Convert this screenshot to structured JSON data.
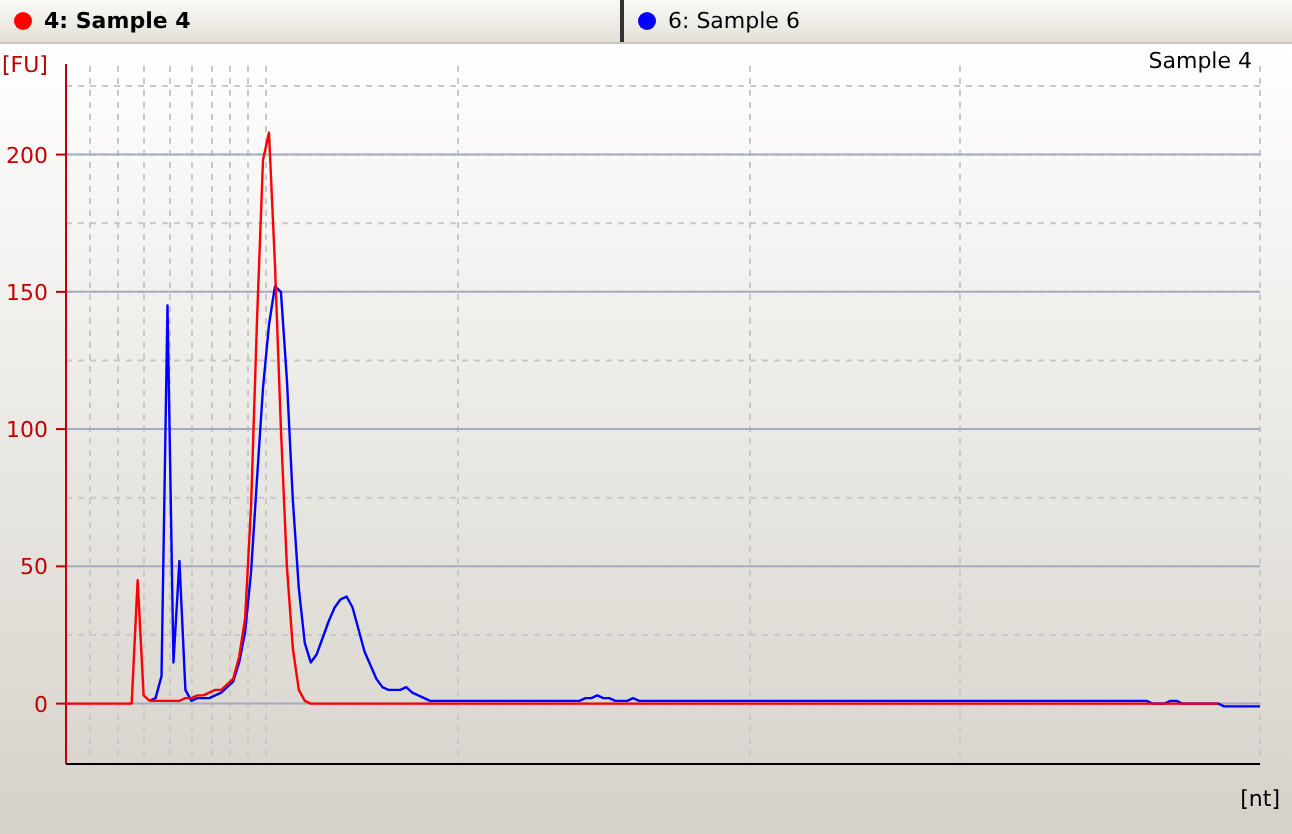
{
  "tabs": [
    {
      "label": "4: Sample 4",
      "color": "#ff0000",
      "selected": true
    },
    {
      "label": "6: Sample 6",
      "color": "#0000ff",
      "selected": false
    }
  ],
  "chart": {
    "chart_data": {
      "type": "line",
      "title": "Sample 4",
      "ylabel": "[FU]",
      "xlabel": "[nt]",
      "ylim": [
        -22,
        233
      ],
      "yticks": [
        0,
        50,
        100,
        150,
        200
      ],
      "grid": true,
      "categories": [
        null,
        null,
        null,
        null,
        null,
        null,
        null,
        null,
        null,
        null,
        null,
        null,
        null,
        null,
        null,
        null,
        null,
        null,
        null,
        null,
        null,
        null,
        null,
        null,
        null,
        null,
        null,
        null,
        null,
        null,
        null,
        null,
        null,
        null,
        null,
        null,
        null,
        null,
        null,
        null,
        null,
        null,
        null,
        null,
        null,
        null,
        null,
        null,
        null,
        null,
        null,
        null,
        null,
        null,
        null,
        null,
        null,
        null,
        null,
        null,
        null,
        null,
        null,
        null,
        null,
        null,
        null,
        null,
        null,
        null,
        null,
        null,
        null,
        null,
        null,
        null,
        null,
        null,
        null,
        null,
        null,
        null,
        null,
        null,
        null,
        null,
        null,
        null,
        null,
        null,
        null,
        null,
        null,
        null,
        null,
        null,
        null,
        null,
        null,
        null,
        null,
        null,
        null,
        null,
        null,
        null,
        null,
        null,
        null,
        null,
        null,
        null,
        null,
        null,
        null,
        null,
        null,
        null,
        null,
        null,
        null,
        null,
        null,
        null,
        null,
        null,
        null,
        null,
        null,
        null,
        null,
        null,
        null,
        null,
        null,
        null,
        null,
        null,
        null,
        null,
        null,
        null,
        null,
        null,
        null,
        null,
        null,
        null,
        null,
        null,
        null,
        null,
        null,
        null,
        null,
        null,
        null,
        null,
        null,
        null,
        null,
        null,
        null,
        null,
        null,
        null,
        null,
        null,
        null,
        null,
        null,
        null,
        null,
        null,
        null,
        null,
        null,
        null,
        null,
        null,
        null,
        null,
        null,
        null,
        null,
        null,
        null,
        null,
        null,
        null,
        null,
        null,
        null,
        null,
        null,
        null,
        null,
        null,
        null,
        null,
        null
      ],
      "series": [
        {
          "color": "#0000ff",
          "values": [
            null,
            null,
            null,
            null,
            null,
            null,
            null,
            null,
            null,
            null,
            null,
            null,
            null,
            null,
            1,
            2,
            10,
            145,
            15,
            52,
            5,
            1,
            2,
            2,
            2,
            3,
            4,
            6,
            8,
            15,
            26,
            48,
            82,
            115,
            138,
            152,
            150,
            118,
            74,
            42,
            22,
            15,
            18,
            24,
            30,
            35,
            38,
            39,
            35,
            27,
            19,
            14,
            9,
            6,
            5,
            5,
            5,
            6,
            4,
            3,
            2,
            1,
            1,
            1,
            1,
            1,
            1,
            1,
            1,
            1,
            1,
            1,
            1,
            1,
            1,
            1,
            1,
            1,
            1,
            1,
            1,
            1,
            1,
            1,
            1,
            1,
            1,
            2,
            2,
            3,
            2,
            2,
            1,
            1,
            1,
            2,
            1,
            1,
            1,
            1,
            1,
            1,
            1,
            1,
            1,
            1,
            1,
            1,
            1,
            1,
            1,
            1,
            1,
            1,
            1,
            1,
            1,
            1,
            1,
            1,
            1,
            1,
            1,
            1,
            1,
            1,
            1,
            1,
            1,
            1,
            1,
            1,
            1,
            1,
            1,
            1,
            1,
            1,
            1,
            1,
            1,
            1,
            1,
            1,
            1,
            1,
            1,
            1,
            1,
            1,
            1,
            1,
            1,
            1,
            1,
            1,
            1,
            1,
            1,
            1,
            1,
            1,
            1,
            1,
            1,
            1,
            1,
            1,
            1,
            1,
            1,
            1,
            1,
            1,
            1,
            1,
            1,
            1,
            1,
            1,
            1,
            1,
            0,
            0,
            0,
            1,
            1,
            0,
            0,
            0,
            0,
            0,
            0,
            0,
            -1,
            -1,
            -1,
            -1,
            -1,
            -1,
            -1
          ]
        },
        {
          "color": "#ff0000",
          "values": [
            0,
            0,
            0,
            0,
            0,
            0,
            0,
            0,
            0,
            0,
            0,
            0,
            45,
            3,
            1,
            1,
            1,
            1,
            1,
            1,
            2,
            2,
            3,
            3,
            4,
            5,
            5,
            7,
            9,
            17,
            31,
            72,
            140,
            198,
            208,
            160,
            100,
            50,
            20,
            5,
            1,
            0,
            0,
            0,
            0,
            0,
            0,
            0,
            0,
            0,
            0,
            0,
            0,
            0,
            0,
            0,
            0,
            0,
            0,
            0,
            0,
            0,
            0,
            0,
            0,
            0,
            0,
            0,
            0,
            0,
            0,
            0,
            0,
            0,
            0,
            0,
            0,
            0,
            0,
            0,
            0,
            0,
            0,
            0,
            0,
            0,
            0,
            0,
            0,
            0,
            0,
            0,
            0,
            0,
            0,
            0,
            0,
            0,
            0,
            0,
            0,
            0,
            0,
            0,
            0,
            0,
            0,
            0,
            0,
            0,
            0,
            0,
            0,
            0,
            0,
            0,
            0,
            0,
            0,
            0,
            0,
            0,
            0,
            0,
            0,
            0,
            0,
            0,
            0,
            0,
            0,
            0,
            0,
            0,
            0,
            0,
            0,
            0,
            0,
            0,
            0,
            0,
            0,
            0,
            0,
            0,
            0,
            0,
            0,
            0,
            0,
            0,
            0,
            0,
            0,
            0,
            0,
            0,
            0,
            0,
            0,
            0,
            0,
            0,
            0,
            0,
            0,
            0,
            0,
            0,
            0,
            0,
            0,
            0,
            0,
            0,
            0,
            0,
            0,
            0,
            0,
            0,
            0,
            0,
            0,
            0,
            0,
            0,
            0,
            0,
            0,
            0,
            0,
            0,
            null,
            null,
            null,
            null,
            null,
            null,
            null
          ]
        }
      ]
    }
  }
}
